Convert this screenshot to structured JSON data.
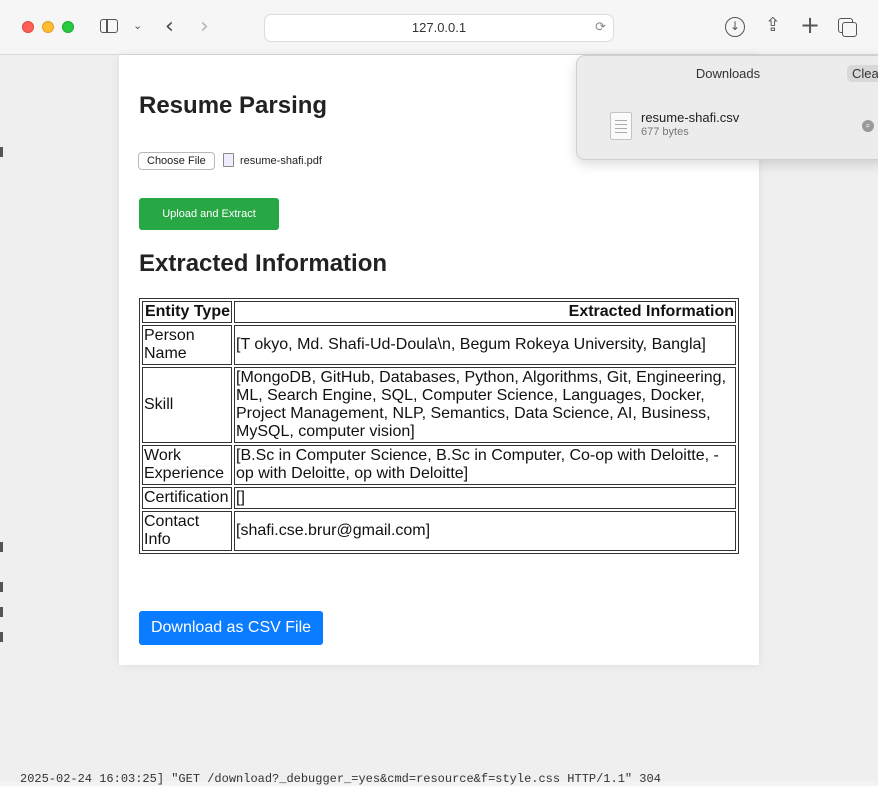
{
  "browser": {
    "url": "127.0.0.1",
    "icons": [
      "sidebar-icon",
      "chevron-down-icon",
      "back-icon",
      "forward-icon",
      "translate-icon",
      "reload-icon",
      "download-icon",
      "share-icon",
      "new-tab-icon",
      "tab-overview-icon"
    ]
  },
  "page": {
    "title": "Resume Parsing",
    "choose_file_label": "Choose File",
    "selected_file": "resume-shafi.pdf",
    "upload_button": "Upload and Extract",
    "extracted_heading": "Extracted Information",
    "table": {
      "headers": [
        "Entity Type",
        "Extracted Information"
      ],
      "rows": [
        {
          "type": "Person Name",
          "value": "[T okyo, Md. Shafi-Ud-Doula\\n, Begum Rokeya University, Bangla]"
        },
        {
          "type": "Skill",
          "value": "[MongoDB, GitHub, Databases, Python, Algorithms, Git, Engineering, ML, Search Engine, SQL, Computer Science, Languages, Docker, Project Management, NLP, Semantics, Data Science, AI, Business, MySQL, computer vision]"
        },
        {
          "type": "Work Experience",
          "value": "[B.Sc in Computer Science, B.Sc in Computer, Co-op with Deloitte, -op with Deloitte, op with Deloitte]"
        },
        {
          "type": "Certification",
          "value": "[]"
        },
        {
          "type": "Contact Info",
          "value": "[shafi.cse.brur@gmail.com]"
        }
      ]
    },
    "download_button": "Download as CSV File",
    "colors": {
      "upload": "#28a745",
      "download": "#0a7cff"
    }
  },
  "downloads": {
    "title": "Downloads",
    "clear_label": "Clea",
    "file_name": "resume-shafi.csv",
    "file_size": "677 bytes"
  },
  "background_text": "2025-02-24 16:03:25] \"GET /download?_debugger_=yes&cmd=resource&f=style.css HTTP/1.1\" 304"
}
